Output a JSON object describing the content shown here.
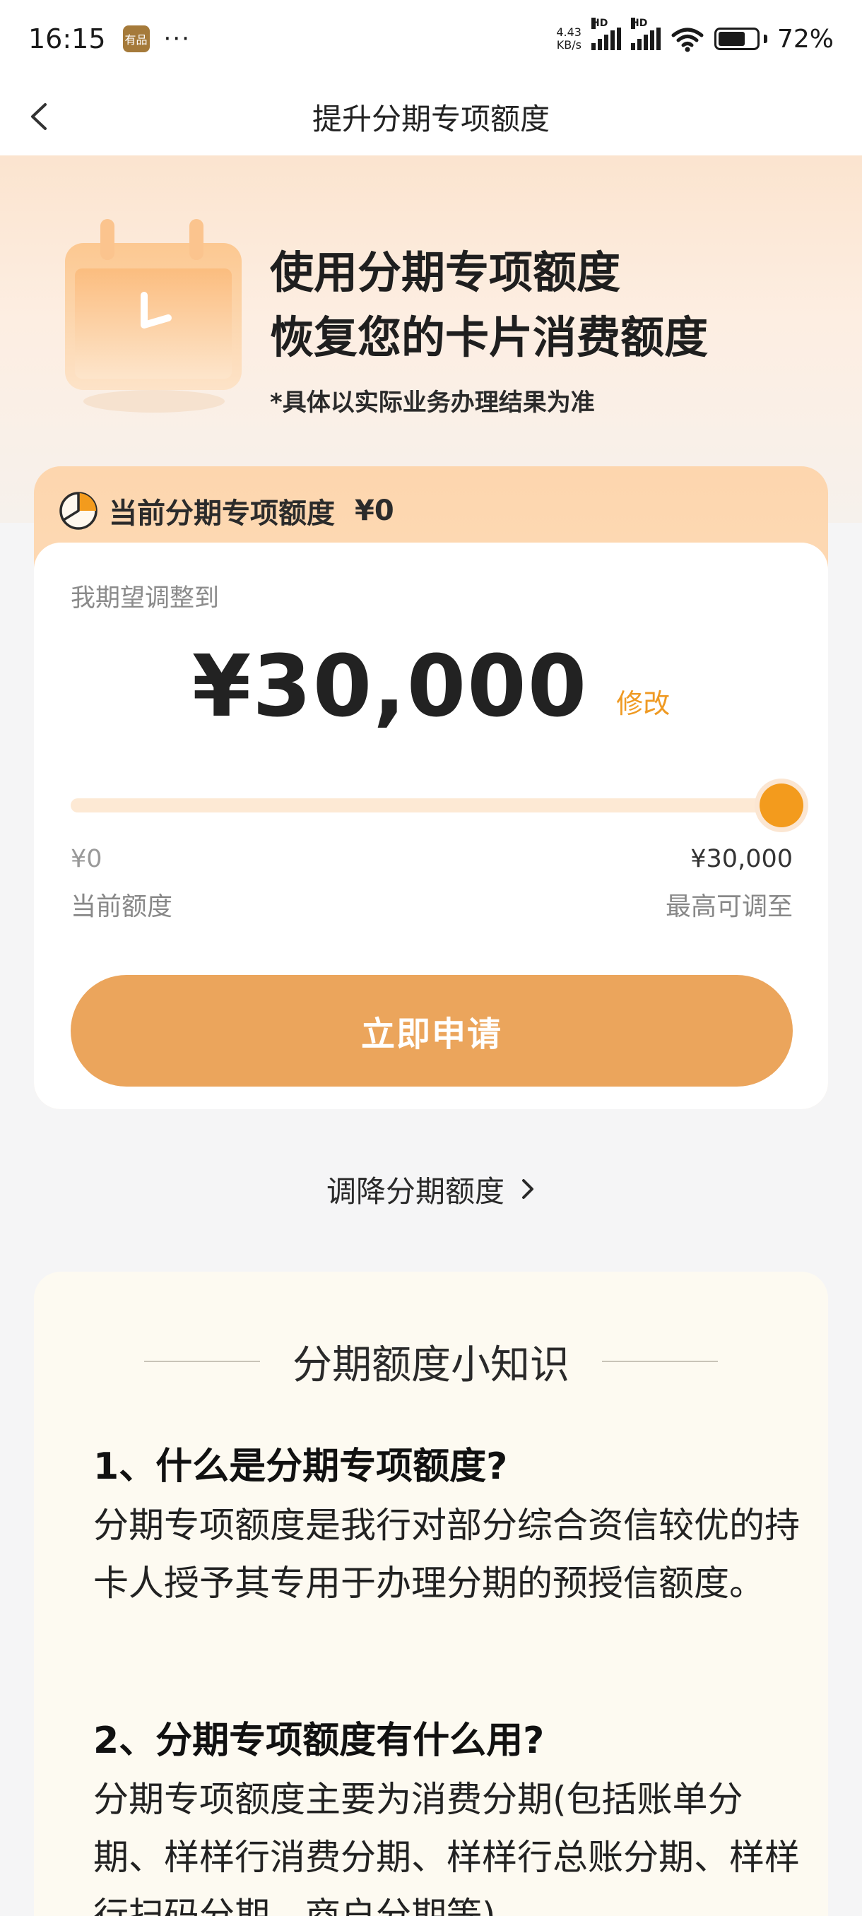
{
  "status_bar": {
    "time": "16:15",
    "app_badge": "有品",
    "more": "···",
    "net_speed_value": "4.43",
    "net_speed_unit": "KB/s",
    "hd_label": "HD",
    "battery_percent": "72%",
    "battery_level": 0.72
  },
  "nav": {
    "title": "提升分期专项额度"
  },
  "hero": {
    "title_line1": "使用分期专项额度",
    "title_line2": "恢复您的卡片消费额度",
    "note": "*具体以实际业务办理结果为准"
  },
  "quota": {
    "current_label": "当前分期专项额度",
    "current_value": "¥0",
    "expect_label": "我期望调整到",
    "amount": "¥30,000",
    "edit_label": "修改",
    "slider_fraction": 1.0,
    "min_value": "¥0",
    "max_value": "¥30,000",
    "min_label": "当前额度",
    "max_label": "最高可调至",
    "apply_label": "立即申请"
  },
  "decrease": {
    "label": "调降分期额度"
  },
  "knowledge": {
    "title": "分期额度小知识",
    "items": [
      {
        "q": "1、什么是分期专项额度?",
        "a": "分期专项额度是我行对部分综合资信较优的持卡人授予其专用于办理分期的预授信额度。"
      },
      {
        "q": "2、分期专项额度有什么用?",
        "a": "分期专项额度主要为消费分期(包括账单分期、样样行消费分期、样样行总账分期、样样行扫码分期、商户分期等)"
      }
    ]
  },
  "colors": {
    "accent": "#f39b1d",
    "button": "#eba55c",
    "edit_link": "#ef9a23"
  }
}
